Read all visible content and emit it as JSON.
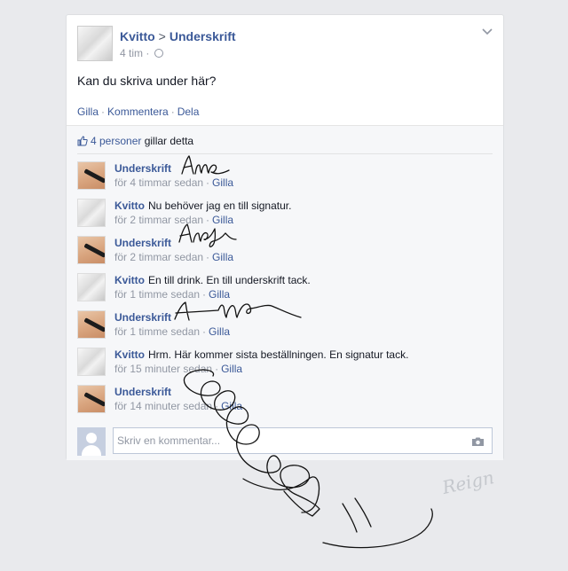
{
  "post": {
    "author": "Kvitto",
    "separator": ">",
    "target": "Underskrift",
    "time": "4 tim ·",
    "text": "Kan du skriva under här?",
    "actions": {
      "like": "Gilla",
      "comment": "Kommentera",
      "share": "Dela",
      "dot": "·"
    }
  },
  "likes": {
    "count_text": "4 personer",
    "suffix": " gillar detta"
  },
  "comments": [
    {
      "avatar": "pen-hand",
      "name": "Underskrift",
      "text": "",
      "time": "för 4 timmar sedan",
      "like": "Gilla"
    },
    {
      "avatar": "kvitto-roll",
      "name": "Kvitto",
      "text": "Nu behöver jag en till signatur.",
      "time": "för 2 timmar sedan",
      "like": "Gilla"
    },
    {
      "avatar": "pen-hand",
      "name": "Underskrift",
      "text": "",
      "time": "för 2 timmar sedan",
      "like": "Gilla"
    },
    {
      "avatar": "kvitto-roll",
      "name": "Kvitto",
      "text": "En till drink. En till underskrift tack.",
      "time": "för 1 timme sedan",
      "like": "Gilla"
    },
    {
      "avatar": "pen-hand",
      "name": "Underskrift",
      "text": "",
      "time": "för 1 timme sedan",
      "like": "Gilla"
    },
    {
      "avatar": "kvitto-roll",
      "name": "Kvitto",
      "text": "Hrm. Här kommer sista beställningen. En signatur tack.",
      "time": "för 15 minuter sedan",
      "like": "Gilla"
    },
    {
      "avatar": "pen-hand",
      "name": "Underskrift",
      "text": "",
      "time": "för 14 minuter sedan",
      "like": "Gilla"
    }
  ],
  "composer": {
    "placeholder": "Skriv en kommentar..."
  },
  "watermark": "Reign",
  "icons": {
    "dropdown": "chevron-down-icon",
    "privacy": "globe-icon",
    "like": "thumbs-up-icon",
    "photo": "camera-icon"
  },
  "colors": {
    "link": "#3b5998",
    "muted": "#9197a3",
    "text": "#141823",
    "background": "#e9eaed"
  }
}
